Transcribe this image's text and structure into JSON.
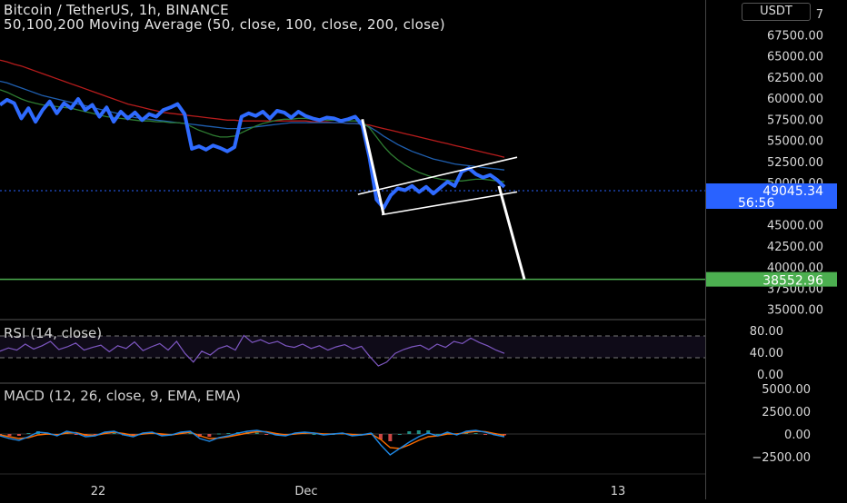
{
  "header": {
    "title": "Bitcoin / TetherUS, 1h, BINANCE",
    "ma_label": "50,100,200 Moving Average (50, close, 100, close, 200, close)"
  },
  "currency_button": "USDT",
  "colors": {
    "price": "#2f6bff",
    "ma50": "#2e7d32",
    "ma100": "#1f5fb0",
    "ma200": "#b71c1c",
    "rsi": "#7e57c2",
    "macd": "#1e88e5",
    "signal": "#ff6d00",
    "support": "#4caf50",
    "pattern": "#ffffff",
    "last_price_tag": "#2962ff"
  },
  "chart_data": [
    {
      "type": "line",
      "name": "price",
      "y_axis_ticks": [
        "35000.00",
        "37500.00",
        "40000.00",
        "42500.00",
        "45000.00",
        "47500.00",
        "50000.00",
        "52500.00",
        "55000.00",
        "57500.00",
        "60000.00",
        "62500.00",
        "65000.00",
        "67500.00",
        "7"
      ],
      "ylim": [
        34000,
        70000
      ],
      "x_ticks": [
        "22",
        "Dec",
        "13"
      ],
      "series": [
        {
          "values": [
            59200,
            59800,
            59400,
            57600,
            58800,
            57200,
            58600,
            59600,
            58200,
            59400,
            58800,
            59900,
            58600,
            59200,
            57800,
            58900,
            57200,
            58400,
            57600,
            58300,
            57400,
            58100,
            57800,
            58600,
            58900,
            59300,
            58100,
            54000,
            54300,
            53900,
            54400,
            54100,
            53700,
            54200,
            57800,
            58200,
            57900,
            58400,
            57600,
            58500,
            58300,
            57700,
            58400,
            57900,
            57600,
            57400,
            57700,
            57600,
            57300,
            57500,
            57800,
            56800,
            53000,
            48000,
            47000,
            48500,
            49300,
            49100,
            49600,
            48900,
            49500,
            48700,
            49400,
            50100,
            49600,
            51300,
            51700,
            51000,
            50600,
            50900,
            50300,
            49500
          ]
        },
        {
          "values": [
            61000,
            60700,
            60300,
            59900,
            59600,
            59400,
            59200,
            59100,
            59000,
            58900,
            58800,
            58600,
            58400,
            58200,
            58000,
            57800,
            57700,
            57600,
            57500,
            57400,
            57300,
            57300,
            57200,
            57200,
            57100,
            57100,
            57000,
            56600,
            56200,
            55900,
            55600,
            55400,
            55400,
            55500,
            55900,
            56300,
            56700,
            57000,
            57200,
            57400,
            57500,
            57500,
            57600,
            57600,
            57500,
            57500,
            57400,
            57400,
            57400,
            57300,
            57300,
            57100,
            56500,
            55400,
            54300,
            53400,
            52700,
            52100,
            51600,
            51200,
            50900,
            50600,
            50400,
            50300,
            50200,
            50200,
            50300,
            50400,
            50400,
            50300,
            50200,
            50100
          ]
        },
        {
          "values": [
            62000,
            61800,
            61500,
            61200,
            60900,
            60600,
            60300,
            60100,
            59900,
            59700,
            59500,
            59300,
            59100,
            58900,
            58700,
            58500,
            58300,
            58100,
            57900,
            57700,
            57600,
            57500,
            57400,
            57300,
            57200,
            57100,
            57000,
            56900,
            56800,
            56700,
            56600,
            56500,
            56400,
            56400,
            56400,
            56500,
            56600,
            56700,
            56800,
            56900,
            57000,
            57100,
            57100,
            57100,
            57100,
            57100,
            57100,
            57100,
            57100,
            57000,
            57000,
            56900,
            56600,
            56100,
            55500,
            55000,
            54500,
            54100,
            53700,
            53400,
            53100,
            52800,
            52600,
            52400,
            52200,
            52100,
            52000,
            51900,
            51800,
            51700,
            51600,
            51500
          ]
        },
        {
          "values": [
            64500,
            64300,
            64000,
            63800,
            63500,
            63200,
            62900,
            62600,
            62300,
            62000,
            61700,
            61400,
            61100,
            60800,
            60500,
            60200,
            59900,
            59600,
            59300,
            59100,
            58900,
            58700,
            58500,
            58300,
            58200,
            58100,
            58000,
            57900,
            57800,
            57700,
            57600,
            57500,
            57400,
            57400,
            57300,
            57300,
            57300,
            57300,
            57300,
            57300,
            57300,
            57300,
            57300,
            57300,
            57200,
            57200,
            57200,
            57100,
            57100,
            57000,
            57000,
            56900,
            56800,
            56600,
            56400,
            56200,
            56000,
            55800,
            55600,
            55400,
            55200,
            55000,
            54800,
            54600,
            54400,
            54200,
            54000,
            53800,
            53600,
            53400,
            53200,
            53000
          ]
        }
      ],
      "last_price": "49045.34",
      "countdown": "56:56",
      "support_level": 38552.96,
      "support_label": "38552.96"
    },
    {
      "type": "line",
      "name": "rsi",
      "y_axis_ticks": [
        "80.00",
        "40.00",
        "0.00"
      ],
      "ylim": [
        0,
        100
      ],
      "bands": [
        30,
        70
      ],
      "series": [
        {
          "values": [
            42,
            48,
            44,
            55,
            46,
            52,
            60,
            45,
            50,
            57,
            44,
            49,
            53,
            41,
            52,
            47,
            59,
            43,
            50,
            56,
            44,
            60,
            38,
            22,
            42,
            35,
            47,
            52,
            44,
            71,
            58,
            63,
            56,
            60,
            52,
            49,
            55,
            47,
            52,
            44,
            50,
            54,
            46,
            51,
            32,
            15,
            22,
            38,
            45,
            50,
            53,
            45,
            55,
            49,
            60,
            56,
            66,
            58,
            52,
            44,
            38
          ]
        }
      ]
    },
    {
      "type": "line",
      "name": "macd",
      "y_axis_ticks": [
        "5000.00",
        "2500.00",
        "0.00",
        "−2500.00"
      ],
      "ylim": [
        -3600,
        5200
      ],
      "series": [
        {
          "values": [
            -200,
            -500,
            -700,
            -300,
            200,
            100,
            -200,
            300,
            100,
            -300,
            -200,
            200,
            300,
            -100,
            -300,
            100,
            200,
            -200,
            -100,
            200,
            300,
            -500,
            -800,
            -400,
            -200,
            100,
            300,
            400,
            200,
            -100,
            -200,
            100,
            200,
            100,
            -100,
            0,
            100,
            -200,
            -100,
            100,
            -1200,
            -2300,
            -1600,
            -900,
            -300,
            100,
            -200,
            200,
            -100,
            300,
            400,
            200,
            -100,
            -300
          ]
        },
        {
          "values": [
            -100,
            -300,
            -500,
            -400,
            -100,
            0,
            -100,
            100,
            150,
            -100,
            -150,
            50,
            200,
            50,
            -150,
            0,
            100,
            0,
            -100,
            50,
            200,
            -200,
            -500,
            -450,
            -300,
            -100,
            100,
            250,
            250,
            50,
            -100,
            0,
            100,
            100,
            0,
            0,
            50,
            -50,
            -100,
            0,
            -600,
            -1500,
            -1600,
            -1200,
            -700,
            -300,
            -200,
            0,
            0,
            150,
            300,
            250,
            50,
            -150
          ]
        }
      ]
    }
  ]
}
